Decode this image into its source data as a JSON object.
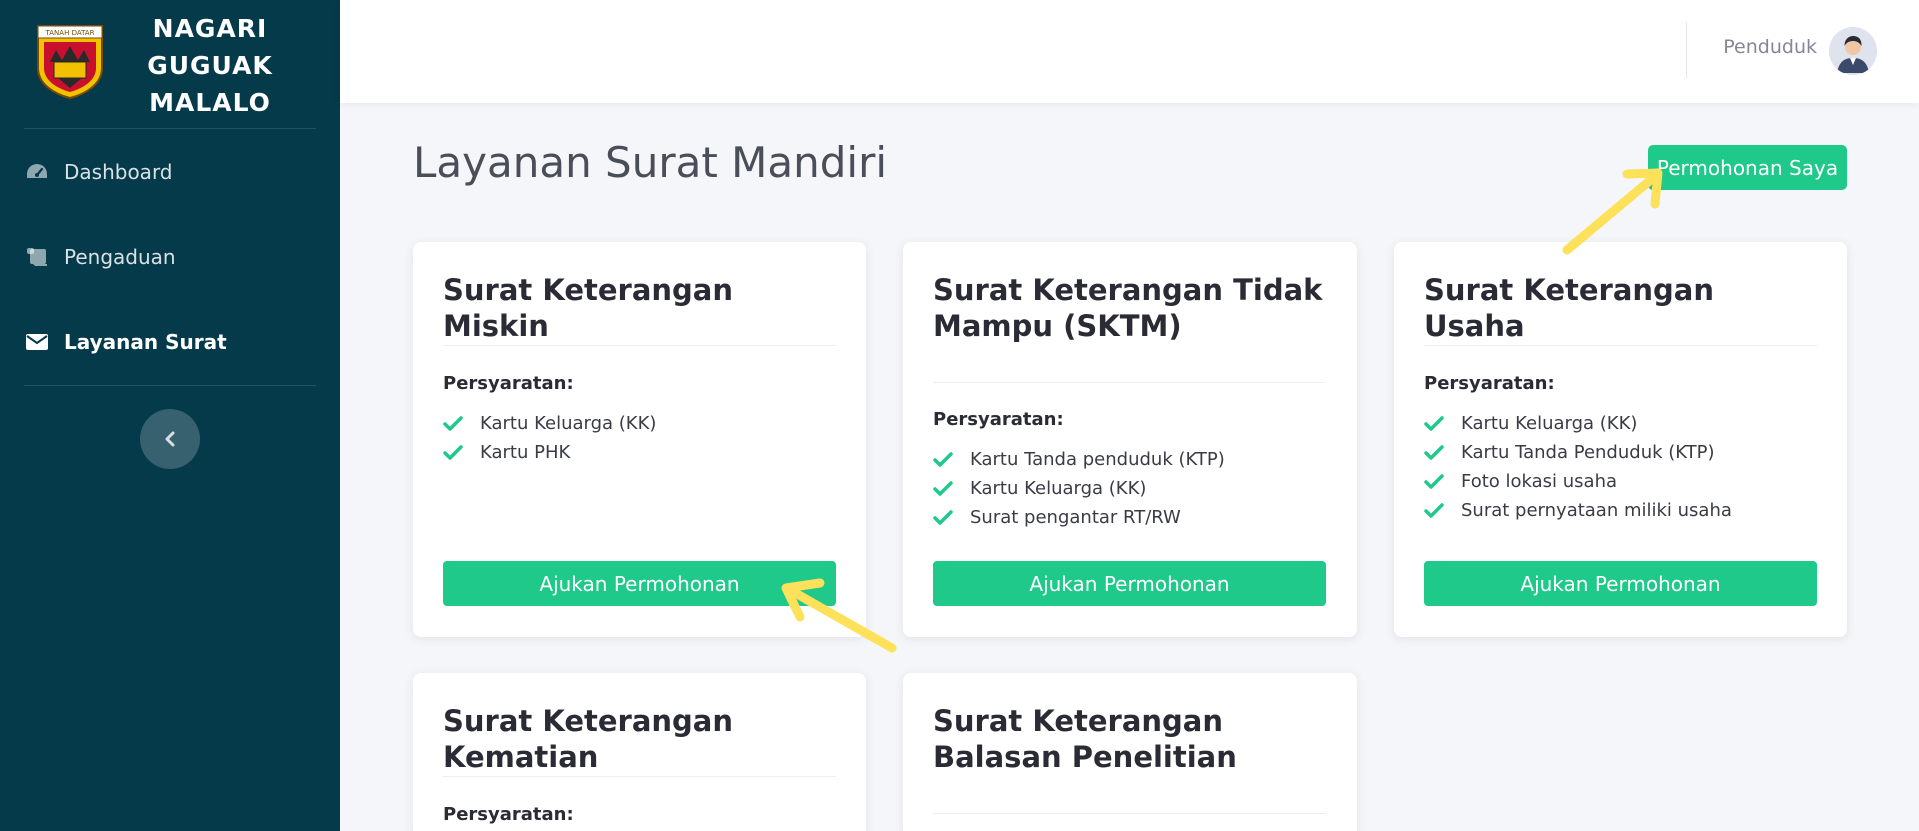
{
  "brand": {
    "name_line1": "NAGARI",
    "name_line2": "GUGUAK",
    "name_line3": "MALALO",
    "logo_text": "TANAH DATAR"
  },
  "sidebar": {
    "items": [
      {
        "label": "Dashboard",
        "icon": "tachometer-icon"
      },
      {
        "label": "Pengaduan",
        "icon": "scroll-icon"
      },
      {
        "label": "Layanan Surat",
        "icon": "envelope-icon",
        "active": true
      }
    ],
    "toggle_icon": "chevron-left-icon"
  },
  "topbar": {
    "user_name": "Penduduk"
  },
  "main": {
    "title": "Layanan Surat Mandiri",
    "my_requests_label": "Permohonan Saya",
    "requirements_label": "Persyaratan:",
    "submit_label": "Ajukan Permohonan",
    "cards": [
      {
        "title": "Surat Keterangan Miskin",
        "requirements": [
          "Kartu Keluarga (KK)",
          "Kartu PHK"
        ]
      },
      {
        "title": "Surat Keterangan Tidak Mampu (SKTM)",
        "requirements": [
          "Kartu Tanda penduduk (KTP)",
          "Kartu Keluarga (KK)",
          "Surat pengantar RT/RW"
        ]
      },
      {
        "title": "Surat Keterangan Usaha",
        "requirements": [
          "Kartu Keluarga (KK)",
          "Kartu Tanda Penduduk (KTP)",
          "Foto lokasi usaha",
          "Surat pernyataan miliki usaha"
        ]
      },
      {
        "title": "Surat Keterangan Kematian"
      },
      {
        "title": "Surat Keterangan Balasan Penelitian"
      }
    ]
  },
  "colors": {
    "sidebar": "#053a4a",
    "accent": "#1ec98a",
    "annotation_arrow": "#fde15a"
  }
}
